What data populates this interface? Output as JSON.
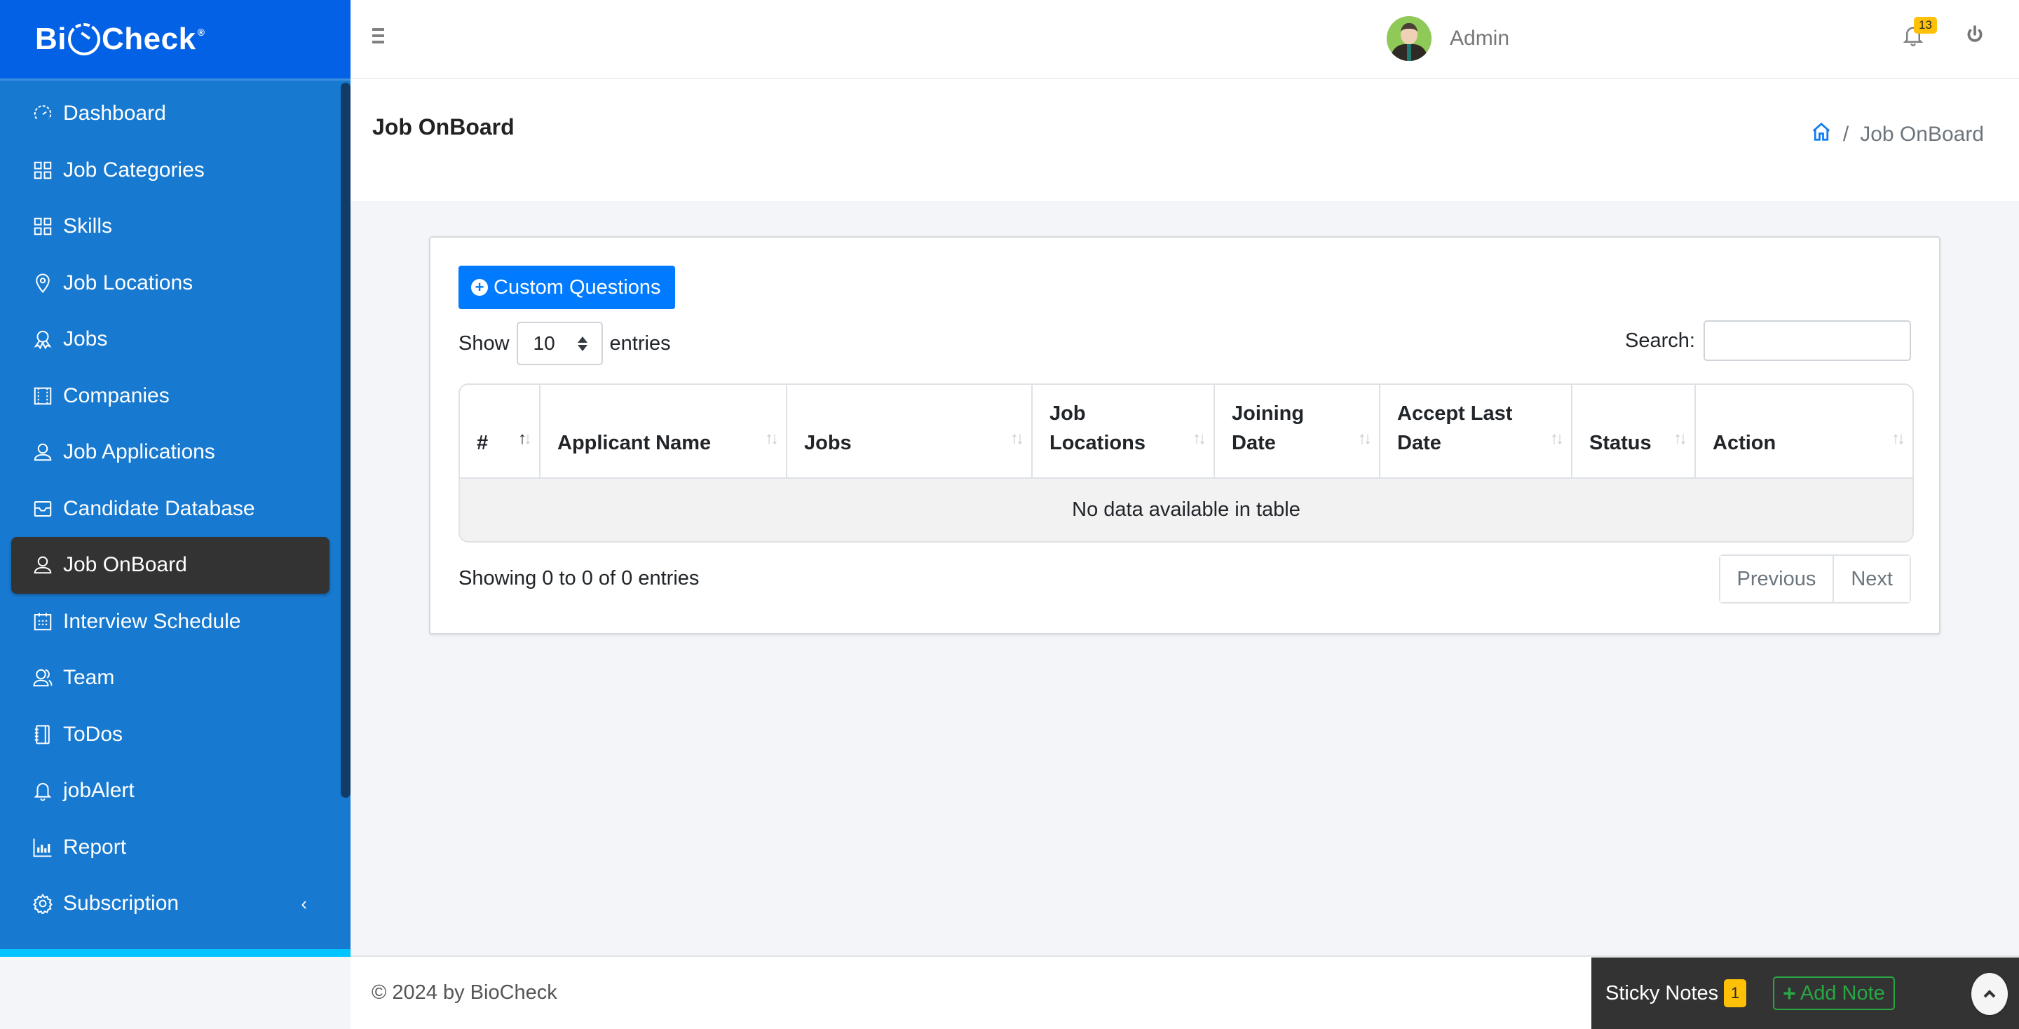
{
  "app": {
    "brand_prefix": "Bi",
    "brand_suffix": "Check",
    "brand_mark": "®"
  },
  "sidebar": {
    "items": [
      {
        "label": "Dashboard",
        "icon": "speedometer-icon"
      },
      {
        "label": "Job Categories",
        "icon": "grid-icon"
      },
      {
        "label": "Skills",
        "icon": "grid-icon"
      },
      {
        "label": "Job Locations",
        "icon": "map-pin-icon"
      },
      {
        "label": "Jobs",
        "icon": "award-icon"
      },
      {
        "label": "Companies",
        "icon": "film-icon"
      },
      {
        "label": "Job Applications",
        "icon": "user-icon"
      },
      {
        "label": "Candidate Database",
        "icon": "inbox-icon"
      },
      {
        "label": "Job OnBoard",
        "icon": "user-icon",
        "active": true
      },
      {
        "label": "Interview Schedule",
        "icon": "calendar-icon"
      },
      {
        "label": "Team",
        "icon": "users-icon"
      },
      {
        "label": "ToDos",
        "icon": "notebook-icon"
      },
      {
        "label": "jobAlert",
        "icon": "bell-icon"
      },
      {
        "label": "Report",
        "icon": "bar-chart-icon"
      },
      {
        "label": "Subscription",
        "icon": "gear-icon",
        "expandable": true
      }
    ],
    "subscription_chevron": "‹"
  },
  "topbar": {
    "user_name": "Admin",
    "notification_count": "13"
  },
  "page": {
    "title": "Job OnBoard",
    "breadcrumb_current": "Job OnBoard",
    "breadcrumb_separator": "/"
  },
  "toolbar": {
    "custom_questions_label": "Custom Questions",
    "show_label": "Show",
    "entries_label": "entries",
    "page_length": "10",
    "search_label": "Search:",
    "search_value": ""
  },
  "table": {
    "columns": [
      {
        "line1": "#",
        "line2": ""
      },
      {
        "line1": "Applicant Name",
        "line2": ""
      },
      {
        "line1": "Jobs",
        "line2": ""
      },
      {
        "line1": "Job",
        "line2": "Locations"
      },
      {
        "line1": "Joining",
        "line2": "Date"
      },
      {
        "line1": "Accept Last",
        "line2": "Date"
      },
      {
        "line1": "Status",
        "line2": ""
      },
      {
        "line1": "Action",
        "line2": ""
      }
    ],
    "empty_message": "No data available in table",
    "sorted_column": "#",
    "sort_direction": "ascending"
  },
  "pagination": {
    "info": "Showing 0 to 0 of 0 entries",
    "previous": "Previous",
    "next": "Next"
  },
  "footer": {
    "copyright": "© 2024 by BioCheck"
  },
  "sticky_notes": {
    "label": "Sticky Notes",
    "count": "1",
    "add_label": "Add Note"
  },
  "colors": {
    "brand_blue": "#0361e6",
    "sidebar_blue": "#1779d0",
    "active_item": "#333333",
    "primary_button": "#007bff",
    "badge_yellow": "#ffc107",
    "success_green": "#28a745"
  }
}
